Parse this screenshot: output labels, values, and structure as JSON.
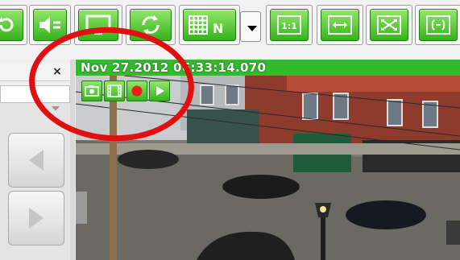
{
  "toolbar": {
    "buttons": [
      {
        "name": "rotate-icon"
      },
      {
        "name": "speaker-mute-icon"
      },
      {
        "name": "monitor-icon"
      },
      {
        "name": "refresh-icon"
      },
      {
        "name": "grid-layout-icon",
        "label": "N"
      },
      {
        "name": "layout-dropdown-icon"
      },
      {
        "name": "actual-size-icon",
        "label": "1:1"
      },
      {
        "name": "fit-width-icon"
      },
      {
        "name": "fullscreen-icon"
      },
      {
        "name": "fit-window-icon"
      }
    ]
  },
  "panel": {
    "close_label": "×"
  },
  "camera": {
    "timestamp": "Nov 27.2012 06:33:14.070",
    "buttons": [
      "snapshot-icon",
      "film-icon",
      "record-icon",
      "play-icon"
    ]
  },
  "colors": {
    "accent_green": "#2fbd2a",
    "annotation_red": "#e01010"
  }
}
